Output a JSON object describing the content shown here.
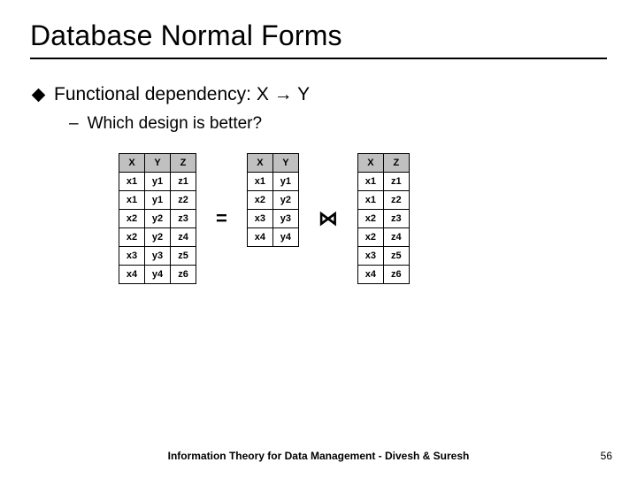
{
  "title": "Database Normal Forms",
  "bullet": "Functional dependency: X → Y",
  "subbullet": "Which design is better?",
  "op_eq": "=",
  "op_join": "⋈",
  "table1": {
    "headers": [
      "X",
      "Y",
      "Z"
    ],
    "rows": [
      [
        "x1",
        "y1",
        "z1"
      ],
      [
        "x1",
        "y1",
        "z2"
      ],
      [
        "x2",
        "y2",
        "z3"
      ],
      [
        "x2",
        "y2",
        "z4"
      ],
      [
        "x3",
        "y3",
        "z5"
      ],
      [
        "x4",
        "y4",
        "z6"
      ]
    ]
  },
  "table2": {
    "headers": [
      "X",
      "Y"
    ],
    "rows": [
      [
        "x1",
        "y1"
      ],
      [
        "x2",
        "y2"
      ],
      [
        "x3",
        "y3"
      ],
      [
        "x4",
        "y4"
      ]
    ]
  },
  "table3": {
    "headers": [
      "X",
      "Z"
    ],
    "rows": [
      [
        "x1",
        "z1"
      ],
      [
        "x1",
        "z2"
      ],
      [
        "x2",
        "z3"
      ],
      [
        "x2",
        "z4"
      ],
      [
        "x3",
        "z5"
      ],
      [
        "x4",
        "z6"
      ]
    ]
  },
  "footer": "Information Theory for Data Management - Divesh & Suresh",
  "page": "56"
}
